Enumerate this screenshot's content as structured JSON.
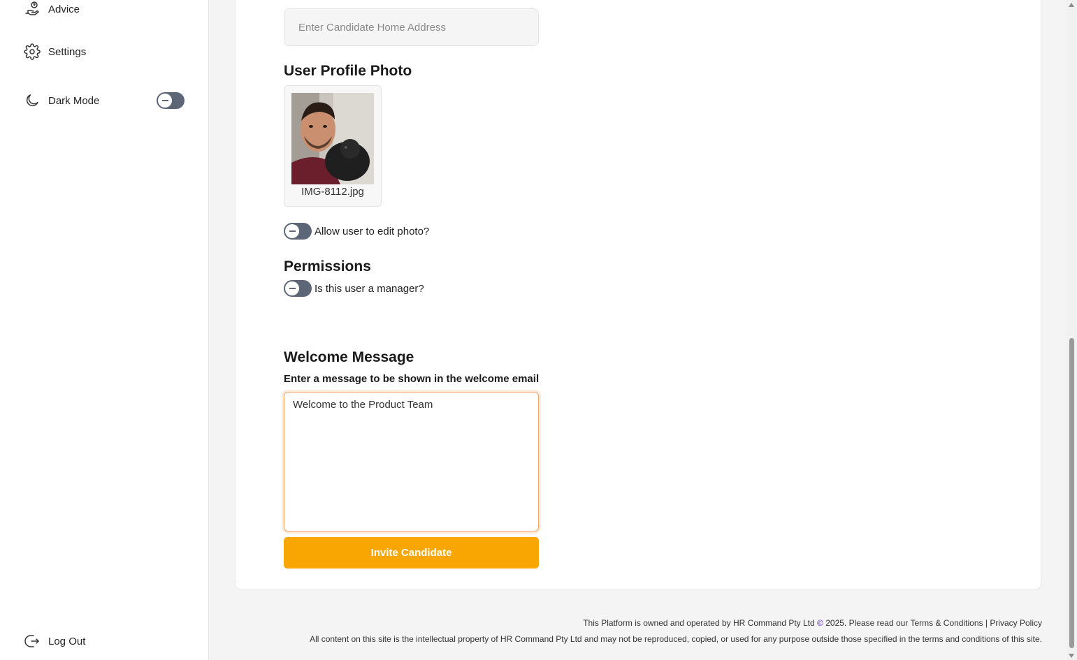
{
  "sidebar": {
    "items": [
      {
        "label": "Advice",
        "icon": "advice-hand-icon"
      },
      {
        "label": "Settings",
        "icon": "gear-icon"
      },
      {
        "label": "Dark Mode",
        "icon": "moon-icon",
        "toggle": false
      }
    ],
    "logout_label": "Log Out"
  },
  "form": {
    "address_placeholder": "Enter Candidate Home Address",
    "photo_section_title": "User Profile Photo",
    "photo_filename": "IMG-8112.jpg",
    "allow_edit_photo_label": "Allow user to edit photo?",
    "permissions_title": "Permissions",
    "manager_label": "Is this user a manager?",
    "welcome_title": "Welcome Message",
    "welcome_sublabel": "Enter a message to be shown in the welcome email",
    "welcome_value": "Welcome to the Product Team",
    "invite_button_label": "Invite Candidate"
  },
  "footer": {
    "line1_prefix": "This Platform is owned and operated by HR Command Pty Ltd",
    "copyright_symbol": "©",
    "line1_suffix": "2025. Please read our",
    "terms_link": "Terms & Conditions",
    "separator": "|",
    "privacy_link": "Privacy Policy",
    "line2": "All content on this site is the intellectual property of HR Command Pty Ltd and may not be reproduced, copied, or used for any purpose outside those specified in the terms and conditions of this site."
  },
  "colors": {
    "accent": "#f9a602",
    "toggle_off": "#5c6677",
    "focus_border": "#f4a46a"
  }
}
